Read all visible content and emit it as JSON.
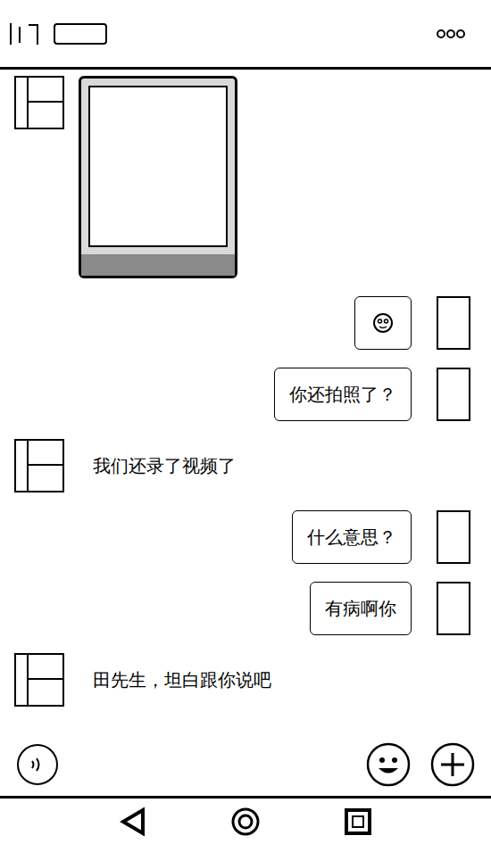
{
  "messages": [
    {
      "side": "left",
      "kind": "image"
    },
    {
      "side": "right",
      "kind": "emoji"
    },
    {
      "side": "right",
      "kind": "text",
      "text": "你还拍照了？"
    },
    {
      "side": "left",
      "kind": "text",
      "text": "我们还录了视频了"
    },
    {
      "side": "right",
      "kind": "text",
      "text": "什么意思？"
    },
    {
      "side": "right",
      "kind": "text",
      "text": "有病啊你"
    },
    {
      "side": "left",
      "kind": "text",
      "text": "田先生，坦白跟你说吧"
    }
  ]
}
